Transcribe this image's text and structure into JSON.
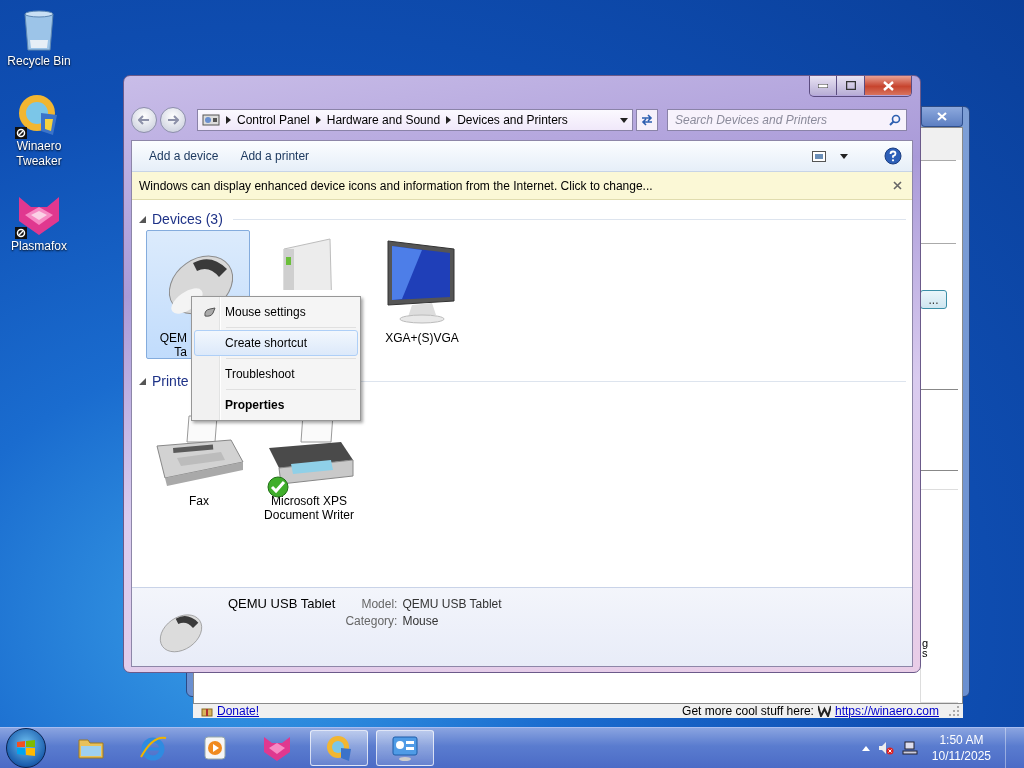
{
  "desktop_icons": [
    {
      "kind": "recycle",
      "lines": [
        "Recycle Bin"
      ],
      "shortcut": false
    },
    {
      "kind": "winaero",
      "lines": [
        "Winaero",
        "Tweaker"
      ],
      "shortcut": true
    },
    {
      "kind": "plasmafox",
      "lines": [
        "Plasmafox"
      ],
      "shortcut": true
    }
  ],
  "back_window": {
    "browse_button": "...",
    "fragments": [
      "g",
      "s"
    ],
    "status_link": "Donate!",
    "promo": "Get more cool stuff here:",
    "site_link": "https://winaero.com"
  },
  "window": {
    "breadcrumbs": [
      "Control Panel",
      "Hardware and Sound",
      "Devices and Printers"
    ],
    "search": {
      "placeholder": "Search Devices and Printers"
    },
    "toolbar": [
      "Add a device",
      "Add a printer"
    ],
    "info_bar": "Windows can display enhanced device icons and information from the Internet. Click to change...",
    "groups": [
      {
        "title": "Devices (3)",
        "expanded": true,
        "items": [
          {
            "kind": "mouse",
            "lines": [
              "QEM",
              "Ta"
            ],
            "selected": true,
            "default": false
          },
          {
            "kind": "computer",
            "selected": false,
            "default": false
          },
          {
            "kind": "monitor",
            "lines": [
              "XGA+(S)VGA"
            ],
            "selected": false,
            "default": false
          }
        ]
      },
      {
        "title": "Printe",
        "expanded": true,
        "items": [
          {
            "kind": "fax",
            "lines": [
              "Fax"
            ],
            "selected": false,
            "default": false
          },
          {
            "kind": "printer",
            "lines": [
              "Microsoft XPS",
              "Document Writer"
            ],
            "selected": false,
            "default": true
          }
        ]
      }
    ],
    "details": {
      "name": "QEMU USB Tablet",
      "fields": [
        {
          "label": "Model:",
          "value": "QEMU USB Tablet"
        },
        {
          "label": "Category:",
          "value": "Mouse"
        }
      ]
    }
  },
  "context_menu": [
    {
      "label": "Mouse settings",
      "kind": "settings",
      "selected": false,
      "bold": false
    },
    {
      "label": "Create shortcut",
      "kind": "plain",
      "selected": true,
      "bold": false
    },
    {
      "label": "Troubleshoot",
      "kind": "plain",
      "selected": false,
      "bold": false
    },
    {
      "label": "Properties",
      "kind": "plain",
      "selected": false,
      "bold": true
    }
  ],
  "taskbar": {
    "apps": [
      {
        "kind": "explorer",
        "active": false
      },
      {
        "kind": "ie",
        "active": false
      },
      {
        "kind": "media",
        "active": false
      },
      {
        "kind": "plasmafox",
        "active": false
      },
      {
        "kind": "winaero",
        "active": true
      },
      {
        "kind": "devices",
        "active": true
      }
    ],
    "time": "1:50 AM",
    "date": "10/11/2025"
  }
}
